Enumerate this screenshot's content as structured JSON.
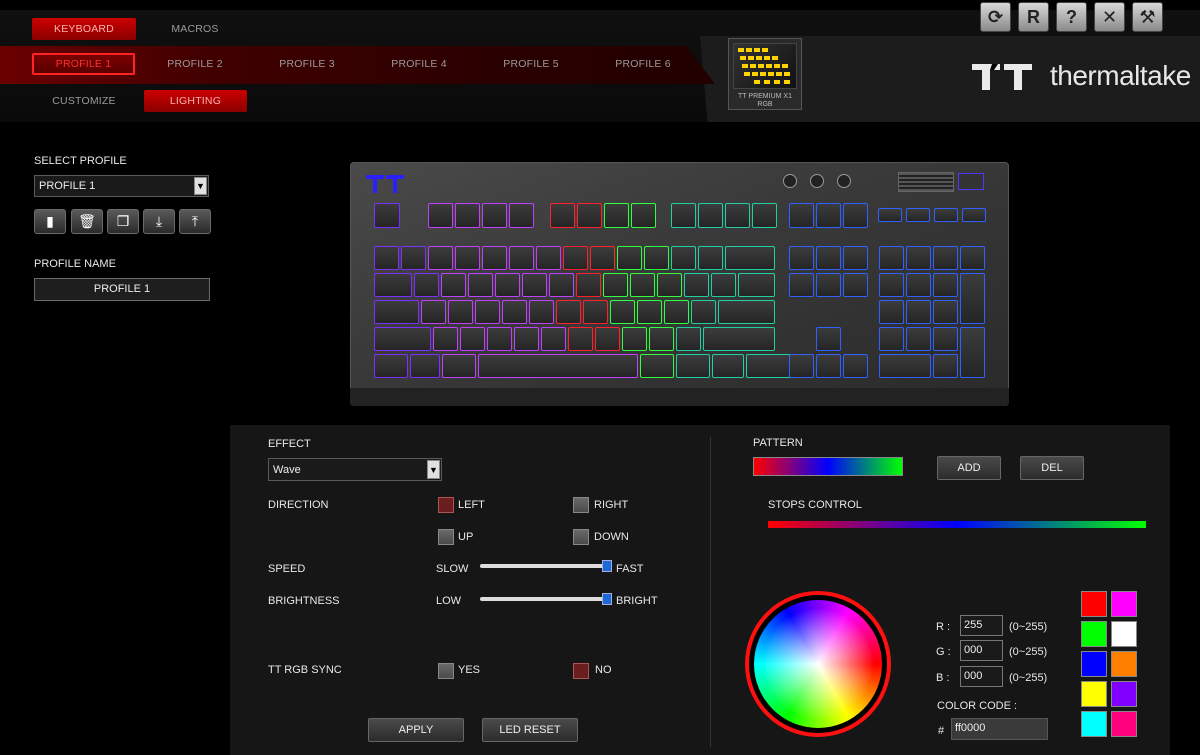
{
  "nav": {
    "top_tabs": [
      {
        "label": "KEYBOARD",
        "active": true
      },
      {
        "label": "MACROS",
        "active": false
      }
    ],
    "profiles": [
      "PROFILE 1",
      "PROFILE 2",
      "PROFILE 3",
      "PROFILE 4",
      "PROFILE 5",
      "PROFILE 6"
    ],
    "active_profile": "PROFILE 1",
    "sub_tabs": [
      {
        "label": "CUSTOMIZE",
        "active": false
      },
      {
        "label": "LIGHTING",
        "active": true
      }
    ]
  },
  "toolbar": {
    "buttons": [
      {
        "name": "refresh-icon",
        "glyph": "⟳"
      },
      {
        "name": "reset-icon",
        "glyph": "R"
      },
      {
        "name": "help-icon",
        "glyph": "?"
      },
      {
        "name": "close-icon",
        "glyph": "✕"
      },
      {
        "name": "settings-icon",
        "glyph": "⚒"
      }
    ]
  },
  "device": {
    "caption_line1": "TT PREMIUM X1",
    "caption_line2": "RGB"
  },
  "brand": {
    "wordmark": "thermaltake"
  },
  "left_panel": {
    "select_profile_label": "SELECT PROFILE",
    "selected_profile": "PROFILE 1",
    "icon_buttons": [
      "new-profile-icon",
      "delete-icon",
      "copy-icon",
      "import-icon",
      "export-icon"
    ],
    "profile_name_label": "PROFILE NAME",
    "profile_name_value": "PROFILE 1"
  },
  "lighting": {
    "effect_label": "EFFECT",
    "effect_value": "Wave",
    "direction_label": "DIRECTION",
    "directions": [
      {
        "label": "LEFT",
        "checked": true
      },
      {
        "label": "RIGHT",
        "checked": false
      },
      {
        "label": "UP",
        "checked": false
      },
      {
        "label": "DOWN",
        "checked": false
      }
    ],
    "speed_label": "SPEED",
    "speed_min": "SLOW",
    "speed_max": "FAST",
    "speed_value": 1.0,
    "brightness_label": "BRIGHTNESS",
    "brightness_min": "LOW",
    "brightness_max": "BRIGHT",
    "brightness_value": 1.0,
    "sync_label": "TT RGB SYNC",
    "sync_yes": "YES",
    "sync_no": "NO",
    "sync_selected": "NO",
    "apply_label": "APPLY",
    "led_reset_label": "LED RESET"
  },
  "pattern": {
    "pattern_label": "PATTERN",
    "add_label": "ADD",
    "del_label": "DEL",
    "stops_label": "STOPS CONTROL",
    "gradient_colors": [
      "#ff0000",
      "#0000ff",
      "#00ff00"
    ]
  },
  "color": {
    "r_label": "R :",
    "g_label": "G :",
    "b_label": "B :",
    "r_value": "255",
    "g_value": "000",
    "b_value": "000",
    "range_hint": "(0~255)",
    "code_label": "COLOR CODE :",
    "hash": "#",
    "code_value": "ff0000",
    "presets": [
      "#ff0000",
      "#ff00ff",
      "#00ff00",
      "#ffffff",
      "#0000ff",
      "#ff7f00",
      "#ffff00",
      "#7f00ff",
      "#00ffff",
      "#ff007f"
    ]
  }
}
